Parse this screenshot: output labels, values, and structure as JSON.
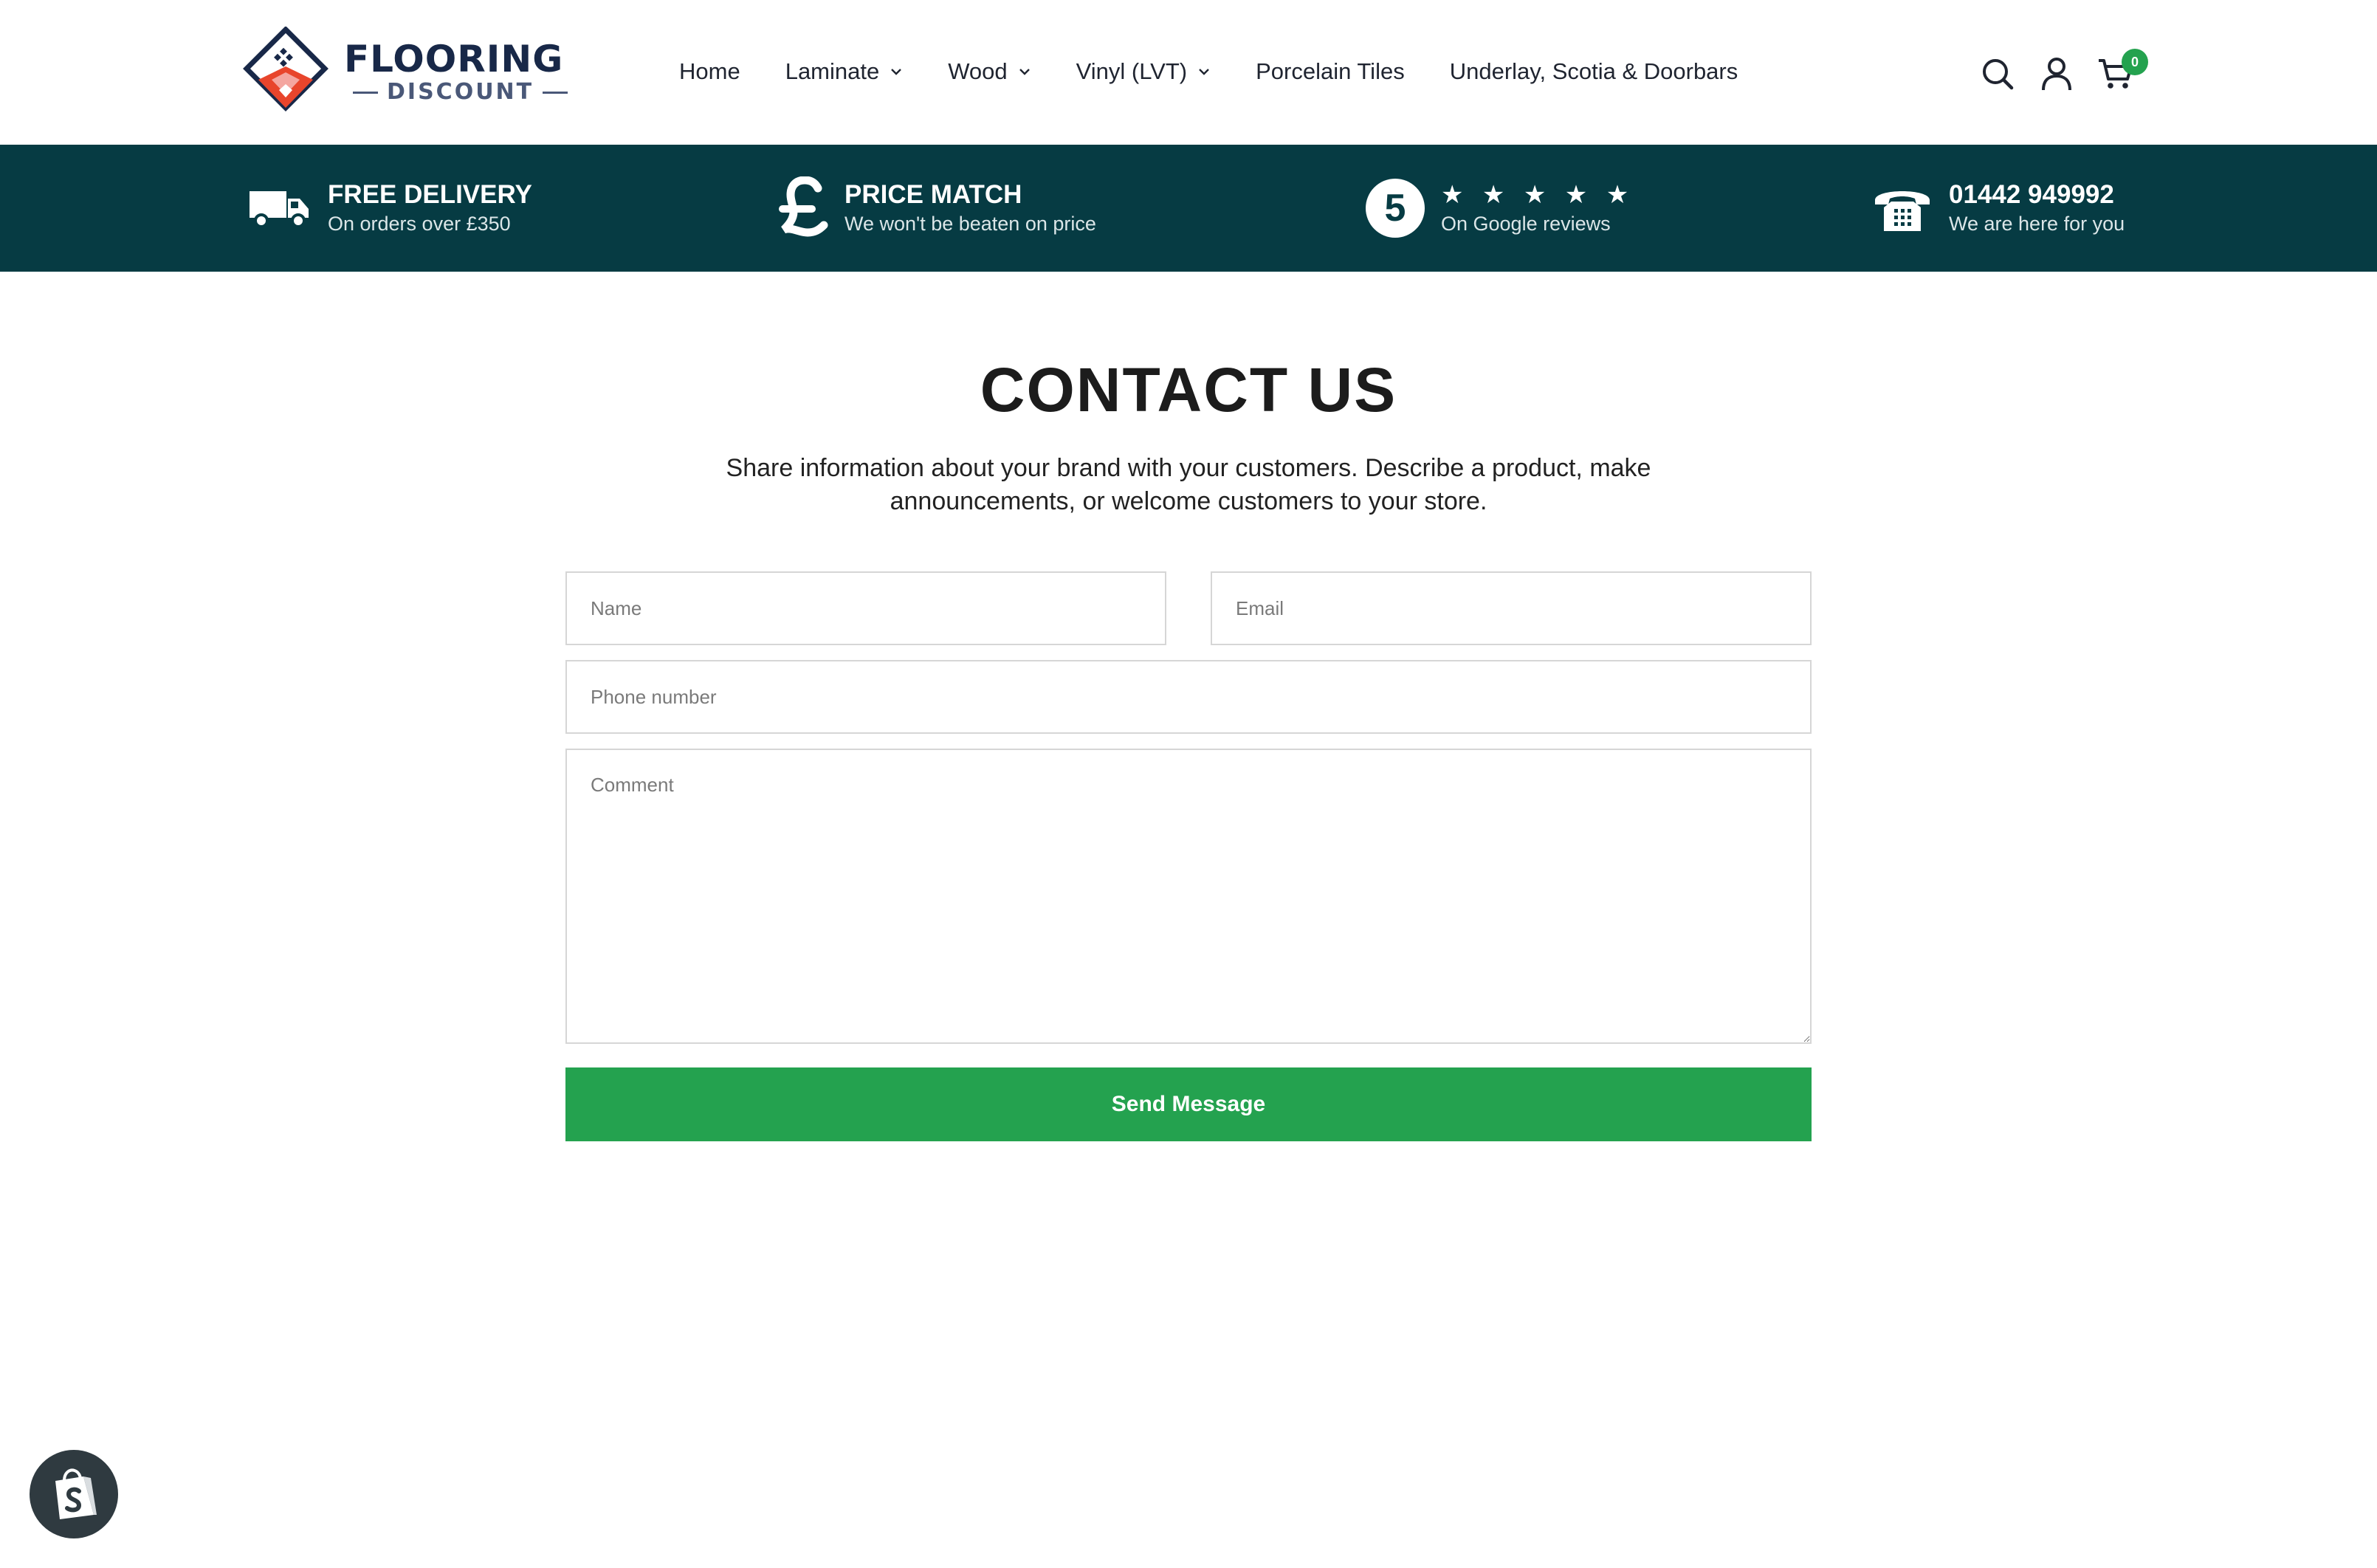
{
  "brand": {
    "line1": "FLOORING",
    "line2": "DISCOUNT"
  },
  "nav": {
    "items": [
      {
        "label": "Home",
        "has_dropdown": false
      },
      {
        "label": "Laminate",
        "has_dropdown": true
      },
      {
        "label": "Wood",
        "has_dropdown": true
      },
      {
        "label": "Vinyl (LVT)",
        "has_dropdown": true
      },
      {
        "label": "Porcelain Tiles",
        "has_dropdown": false
      },
      {
        "label": "Underlay, Scotia & Doorbars",
        "has_dropdown": false
      }
    ]
  },
  "header_icons": {
    "search": "search-icon",
    "account": "user-icon",
    "cart": "cart-icon",
    "cart_count": "0"
  },
  "usp": [
    {
      "icon": "truck-icon",
      "title": "FREE DELIVERY",
      "subtitle": "On orders over £350"
    },
    {
      "icon": "pound-icon",
      "title": "PRICE MATCH",
      "subtitle": "We won't be beaten on price"
    },
    {
      "icon": "rating-badge",
      "badge": "5",
      "stars": "★ ★ ★ ★ ★",
      "subtitle": "On Google reviews"
    },
    {
      "icon": "phone-icon",
      "title": "01442 949992",
      "subtitle": "We are here for you"
    }
  ],
  "main": {
    "title": "CONTACT US",
    "intro": "Share information about your brand with your customers. Describe a product, make announcements, or welcome customers to your store."
  },
  "form": {
    "name": {
      "placeholder": "Name",
      "value": ""
    },
    "email": {
      "placeholder": "Email",
      "value": ""
    },
    "phone": {
      "placeholder": "Phone number",
      "value": ""
    },
    "comment": {
      "placeholder": "Comment",
      "value": ""
    },
    "submit_label": "Send Message"
  },
  "colors": {
    "brand_navy": "#182848",
    "usp_bar": "#063b43",
    "accent_green": "#24a24f",
    "logo_red": "#e8452c"
  },
  "floating": {
    "icon": "shopify-bag-icon"
  }
}
